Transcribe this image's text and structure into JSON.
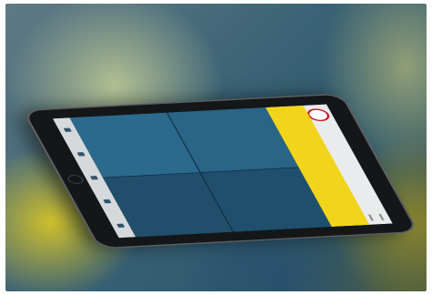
{
  "scene": {
    "description_tag": "",
    "device": "tablet",
    "colors": {
      "banner": "#f2d51a",
      "screen_blue": "#1e4d6a",
      "bezel": "#141618",
      "logo_red": "#c8171e"
    }
  },
  "screen": {
    "banner_label": "",
    "tiles": [
      {
        "label": ""
      },
      {
        "label": ""
      },
      {
        "label": ""
      },
      {
        "label": ""
      }
    ]
  }
}
